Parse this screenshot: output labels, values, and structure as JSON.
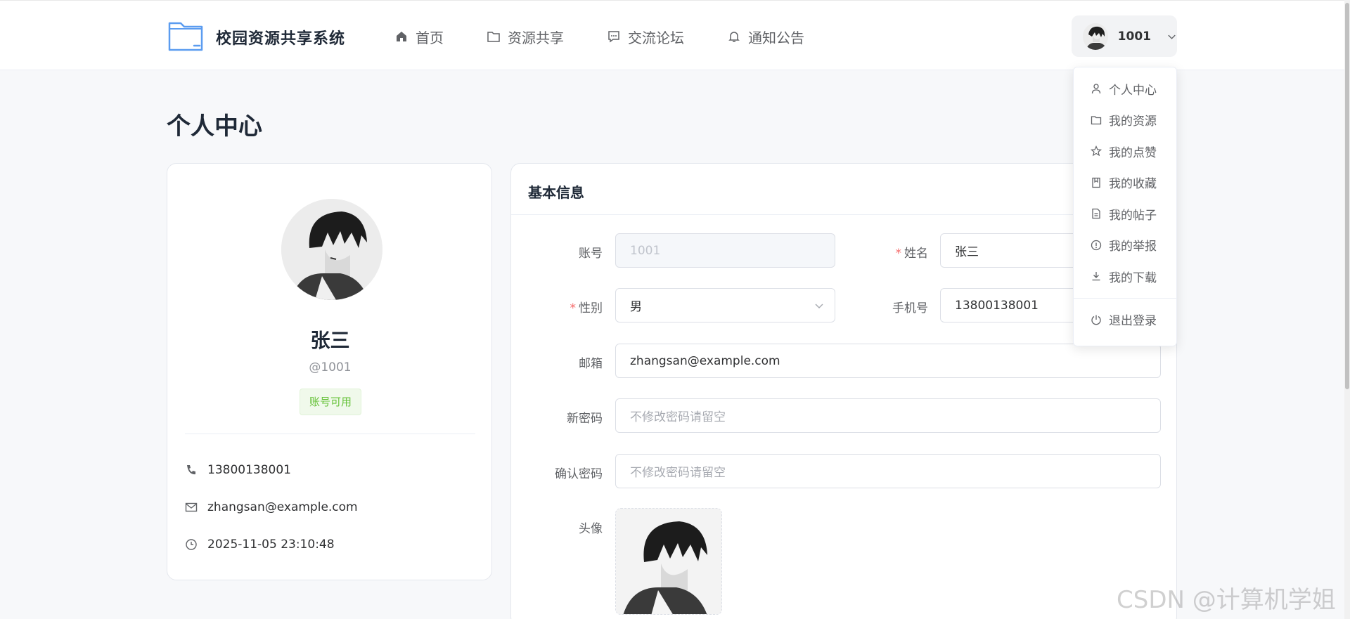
{
  "header": {
    "logo_text": "校园资源共享系统",
    "nav": [
      {
        "label": "首页",
        "icon": "home-icon"
      },
      {
        "label": "资源共享",
        "icon": "folder-icon"
      },
      {
        "label": "交流论坛",
        "icon": "chat-icon"
      },
      {
        "label": "通知公告",
        "icon": "bell-icon"
      }
    ],
    "user": {
      "name": "1001"
    }
  },
  "dropdown": {
    "items": [
      {
        "label": "个人中心",
        "icon": "user-icon"
      },
      {
        "label": "我的资源",
        "icon": "folder-icon"
      },
      {
        "label": "我的点赞",
        "icon": "star-icon"
      },
      {
        "label": "我的收藏",
        "icon": "bookmark-icon"
      },
      {
        "label": "我的帖子",
        "icon": "document-icon"
      },
      {
        "label": "我的举报",
        "icon": "warning-icon"
      },
      {
        "label": "我的下载",
        "icon": "download-icon"
      }
    ],
    "logout": {
      "label": "退出登录",
      "icon": "power-icon"
    }
  },
  "page": {
    "title": "个人中心"
  },
  "profile": {
    "name": "张三",
    "handle": "@1001",
    "status": "账号可用",
    "phone": "13800138001",
    "email": "zhangsan@example.com",
    "created": "2025-11-05 23:10:48"
  },
  "form": {
    "title": "基本信息",
    "account": {
      "label": "账号",
      "value": "1001"
    },
    "name": {
      "label": "姓名",
      "value": "张三"
    },
    "gender": {
      "label": "性别",
      "value": "男"
    },
    "phone": {
      "label": "手机号",
      "value": "13800138001"
    },
    "email": {
      "label": "邮箱",
      "value": "zhangsan@example.com"
    },
    "new_password": {
      "label": "新密码",
      "placeholder": "不修改密码请留空"
    },
    "confirm_password": {
      "label": "确认密码",
      "placeholder": "不修改密码请留空"
    },
    "avatar": {
      "label": "头像"
    }
  },
  "watermark": "CSDN @计算机学姐",
  "colors": {
    "accent": "#409eff",
    "required": "#f56c6c",
    "success": "#67c23a"
  }
}
